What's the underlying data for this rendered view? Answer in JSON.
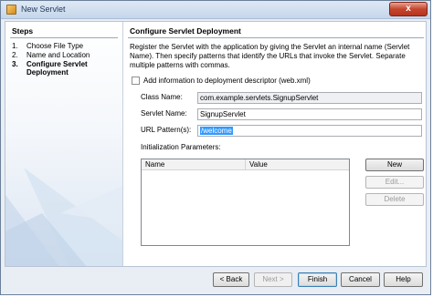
{
  "window": {
    "title": "New Servlet",
    "close_label": "x"
  },
  "steps": {
    "title": "Steps",
    "items": [
      {
        "num": "1.",
        "label": "Choose File Type"
      },
      {
        "num": "2.",
        "label": "Name and Location"
      },
      {
        "num": "3.",
        "label": "Configure Servlet",
        "label2": "Deployment"
      }
    ]
  },
  "main": {
    "title": "Configure Servlet Deployment",
    "description": "Register the Servlet with the application by giving the Servlet an internal name (Servlet Name). Then specify patterns that identify the URLs that invoke the Servlet. Separate multiple patterns with commas.",
    "checkbox_label": "Add information to deployment descriptor (web.xml)",
    "checkbox_checked": false,
    "class_name_label": "Class Name:",
    "class_name_value": "com.example.servlets.SignupServlet",
    "servlet_name_label": "Servlet Name:",
    "servlet_name_value": "SignupServlet",
    "url_patterns_label": "URL Pattern(s):",
    "url_patterns_value": "/welcome",
    "init_params_label": "Initialization Parameters:",
    "table_columns": [
      "Name",
      "Value"
    ]
  },
  "side_buttons": {
    "new": "New",
    "edit": "Edit...",
    "delete": "Delete"
  },
  "footer": {
    "back": "< Back",
    "next": "Next >",
    "finish": "Finish",
    "cancel": "Cancel",
    "help": "Help"
  }
}
